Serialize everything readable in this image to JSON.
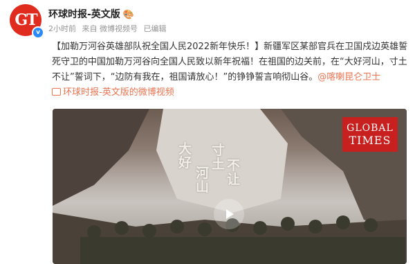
{
  "post": {
    "author_name": "环球时报-英文版",
    "author_emoji": "🎨",
    "avatar_text": "GT",
    "verified_mark": "v",
    "meta": {
      "time": "2小时前",
      "source": "来自 微博视频号",
      "edited": "已编辑"
    },
    "text": {
      "headline": "【加勒万河谷英雄部队祝全国人民2022新年快乐！】",
      "body": "新疆军区某部官兵在卫国戍边英雄誓死守卫的中国加勒万河谷向全国人民致以新年祝福！在祖国的边关前，在“大好河山，寸土不让”誓词下，“边防有我在，祖国请放心！”的铮铮誓言响彻山谷。",
      "mention": "@喀喇昆仑卫士",
      "video_link": "环球时报-英文版的微博视频"
    }
  },
  "video": {
    "banner_line1": "GLOBAL",
    "banner_line2": "TIMES",
    "carving_a1": "大",
    "carving_a2": "好",
    "carving_b1": "河",
    "carving_b2": "山",
    "carving_c1": "寸",
    "carving_c2": "土",
    "carving_d1": "不",
    "carving_d2": "让",
    "brand_color": "#c8201e"
  },
  "colors": {
    "accent_link": "#eb7350",
    "avatar_red": "#e02b1f",
    "verified_blue": "#2a8af7"
  }
}
